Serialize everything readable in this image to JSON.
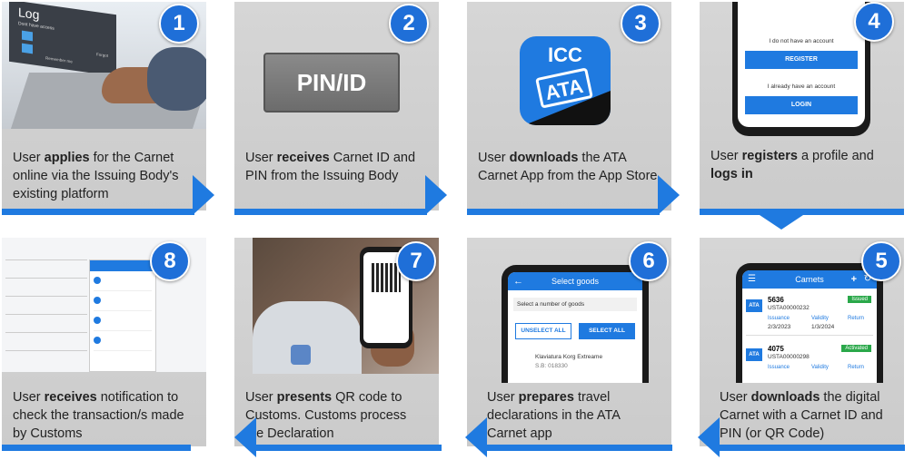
{
  "steps": [
    {
      "number": "1",
      "caption_pre": "User ",
      "caption_bold": "applies",
      "caption_post": " for the Carnet online via the Issuing Body's existing platform"
    },
    {
      "number": "2",
      "caption_pre": "User ",
      "caption_bold": "receives",
      "caption_post": " Carnet ID and PIN from the Issuing Body"
    },
    {
      "number": "3",
      "caption_pre": "User ",
      "caption_bold": "downloads",
      "caption_post": " the ATA Carnet App from the App Store"
    },
    {
      "number": "4",
      "caption_pre": "User ",
      "caption_bold": "registers",
      "caption_mid": " a profile and ",
      "caption_bold2": "logs in"
    },
    {
      "number": "5",
      "caption_pre": "User ",
      "caption_bold": "downloads",
      "caption_post": " the digital Carnet with a Carnet ID and PIN (or QR Code)"
    },
    {
      "number": "6",
      "caption_pre": "User ",
      "caption_bold": "prepares",
      "caption_post": " travel declarations in the ATA Carnet app"
    },
    {
      "number": "7",
      "caption_pre": "User ",
      "caption_bold": "presents",
      "caption_post": " QR code to Customs. Customs process the Declaration"
    },
    {
      "number": "8",
      "caption_pre": "User ",
      "caption_bold": "receives",
      "caption_post": " notification to check the transaction/s made by Customs"
    }
  ],
  "step1_screen": {
    "title": "Log",
    "subtitle": "Dont have access",
    "remember": "Remember me",
    "forgot": "Forgot"
  },
  "step2_box": "PIN/ID",
  "step3_icon": {
    "top": "ICC",
    "bottom": "ATA"
  },
  "step4_screen": {
    "no_account": "I do not have an account",
    "register": "REGISTER",
    "have_account": "I already have an account",
    "login": "LOGIN"
  },
  "step5_screen": {
    "title": "Carnets",
    "items": [
      {
        "id": "5636",
        "code": "USTA00000232",
        "status": "Issued",
        "issuance": "Issuance",
        "validity": "Validity",
        "return": "Return",
        "issuance_date": "2/3/2023",
        "validity_date": "1/3/2024",
        "logo": "ATA"
      },
      {
        "id": "4075",
        "code": "USTA00000298",
        "status": "Activated",
        "issuance": "Issuance",
        "validity": "Validity",
        "return": "Return",
        "logo": "ATA"
      }
    ],
    "status_colors": {
      "Issued": "#2aa84a",
      "Activated": "#2aa84a"
    }
  },
  "step6_screen": {
    "title": "Select goods",
    "prompt": "Select a number of goods",
    "unselect": "UNSELECT ALL",
    "select": "SELECT ALL",
    "item_name": "Klaviatura Korg Extreame",
    "item_code": "S.B: 018330"
  },
  "colors": {
    "accent": "#1f7ae0",
    "badge": "#1f6fd8",
    "panel": "#d1d1d1"
  }
}
